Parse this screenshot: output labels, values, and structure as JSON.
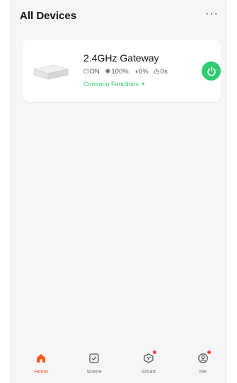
{
  "header": {
    "title": "All Devices",
    "more_label": "···"
  },
  "device": {
    "name": "2.4GHz Gateway",
    "stats": [
      {
        "icon": "power-state-icon",
        "glyph": "⏻",
        "value": "ON"
      },
      {
        "icon": "brightness-icon",
        "glyph": "✺",
        "value": "100%"
      },
      {
        "icon": "contrast-icon",
        "glyph": "◑",
        "value": "0%"
      },
      {
        "icon": "timer-icon",
        "glyph": "◷",
        "value": "0s"
      }
    ],
    "common_functions": "Common Functions"
  },
  "tabs": [
    {
      "label": "Home",
      "icon": "home-icon",
      "active": true
    },
    {
      "label": "Scene",
      "icon": "scene-icon",
      "active": false
    },
    {
      "label": "Smart",
      "icon": "smart-icon",
      "active": false,
      "badge": true
    },
    {
      "label": "Me",
      "icon": "me-icon",
      "active": false,
      "badge": true
    }
  ],
  "colors": {
    "accent": "#ff5a1f",
    "power_on": "#2ecc71",
    "badge": "#ff3b30"
  }
}
